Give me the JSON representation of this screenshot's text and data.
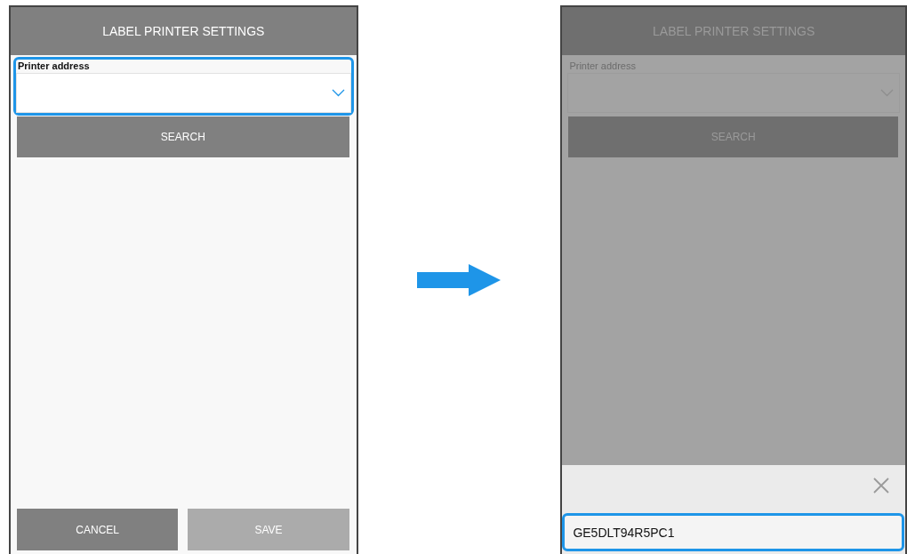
{
  "screens": [
    {
      "title": "LABEL PRINTER SETTINGS",
      "dimmed": false,
      "field": {
        "label": "Printer address",
        "focused": true
      },
      "search_button": "SEARCH",
      "buttons": [
        {
          "label": "CANCEL",
          "disabled": false
        },
        {
          "label": "SAVE",
          "disabled": true
        }
      ]
    },
    {
      "title": "LABEL PRINTER SETTINGS",
      "dimmed": true,
      "field": {
        "label": "Printer address",
        "focused": false
      },
      "search_button": "SEARCH",
      "picker": {
        "items": [
          {
            "label": "GE5DLT94R5PC1",
            "selected": true
          }
        ]
      }
    }
  ]
}
